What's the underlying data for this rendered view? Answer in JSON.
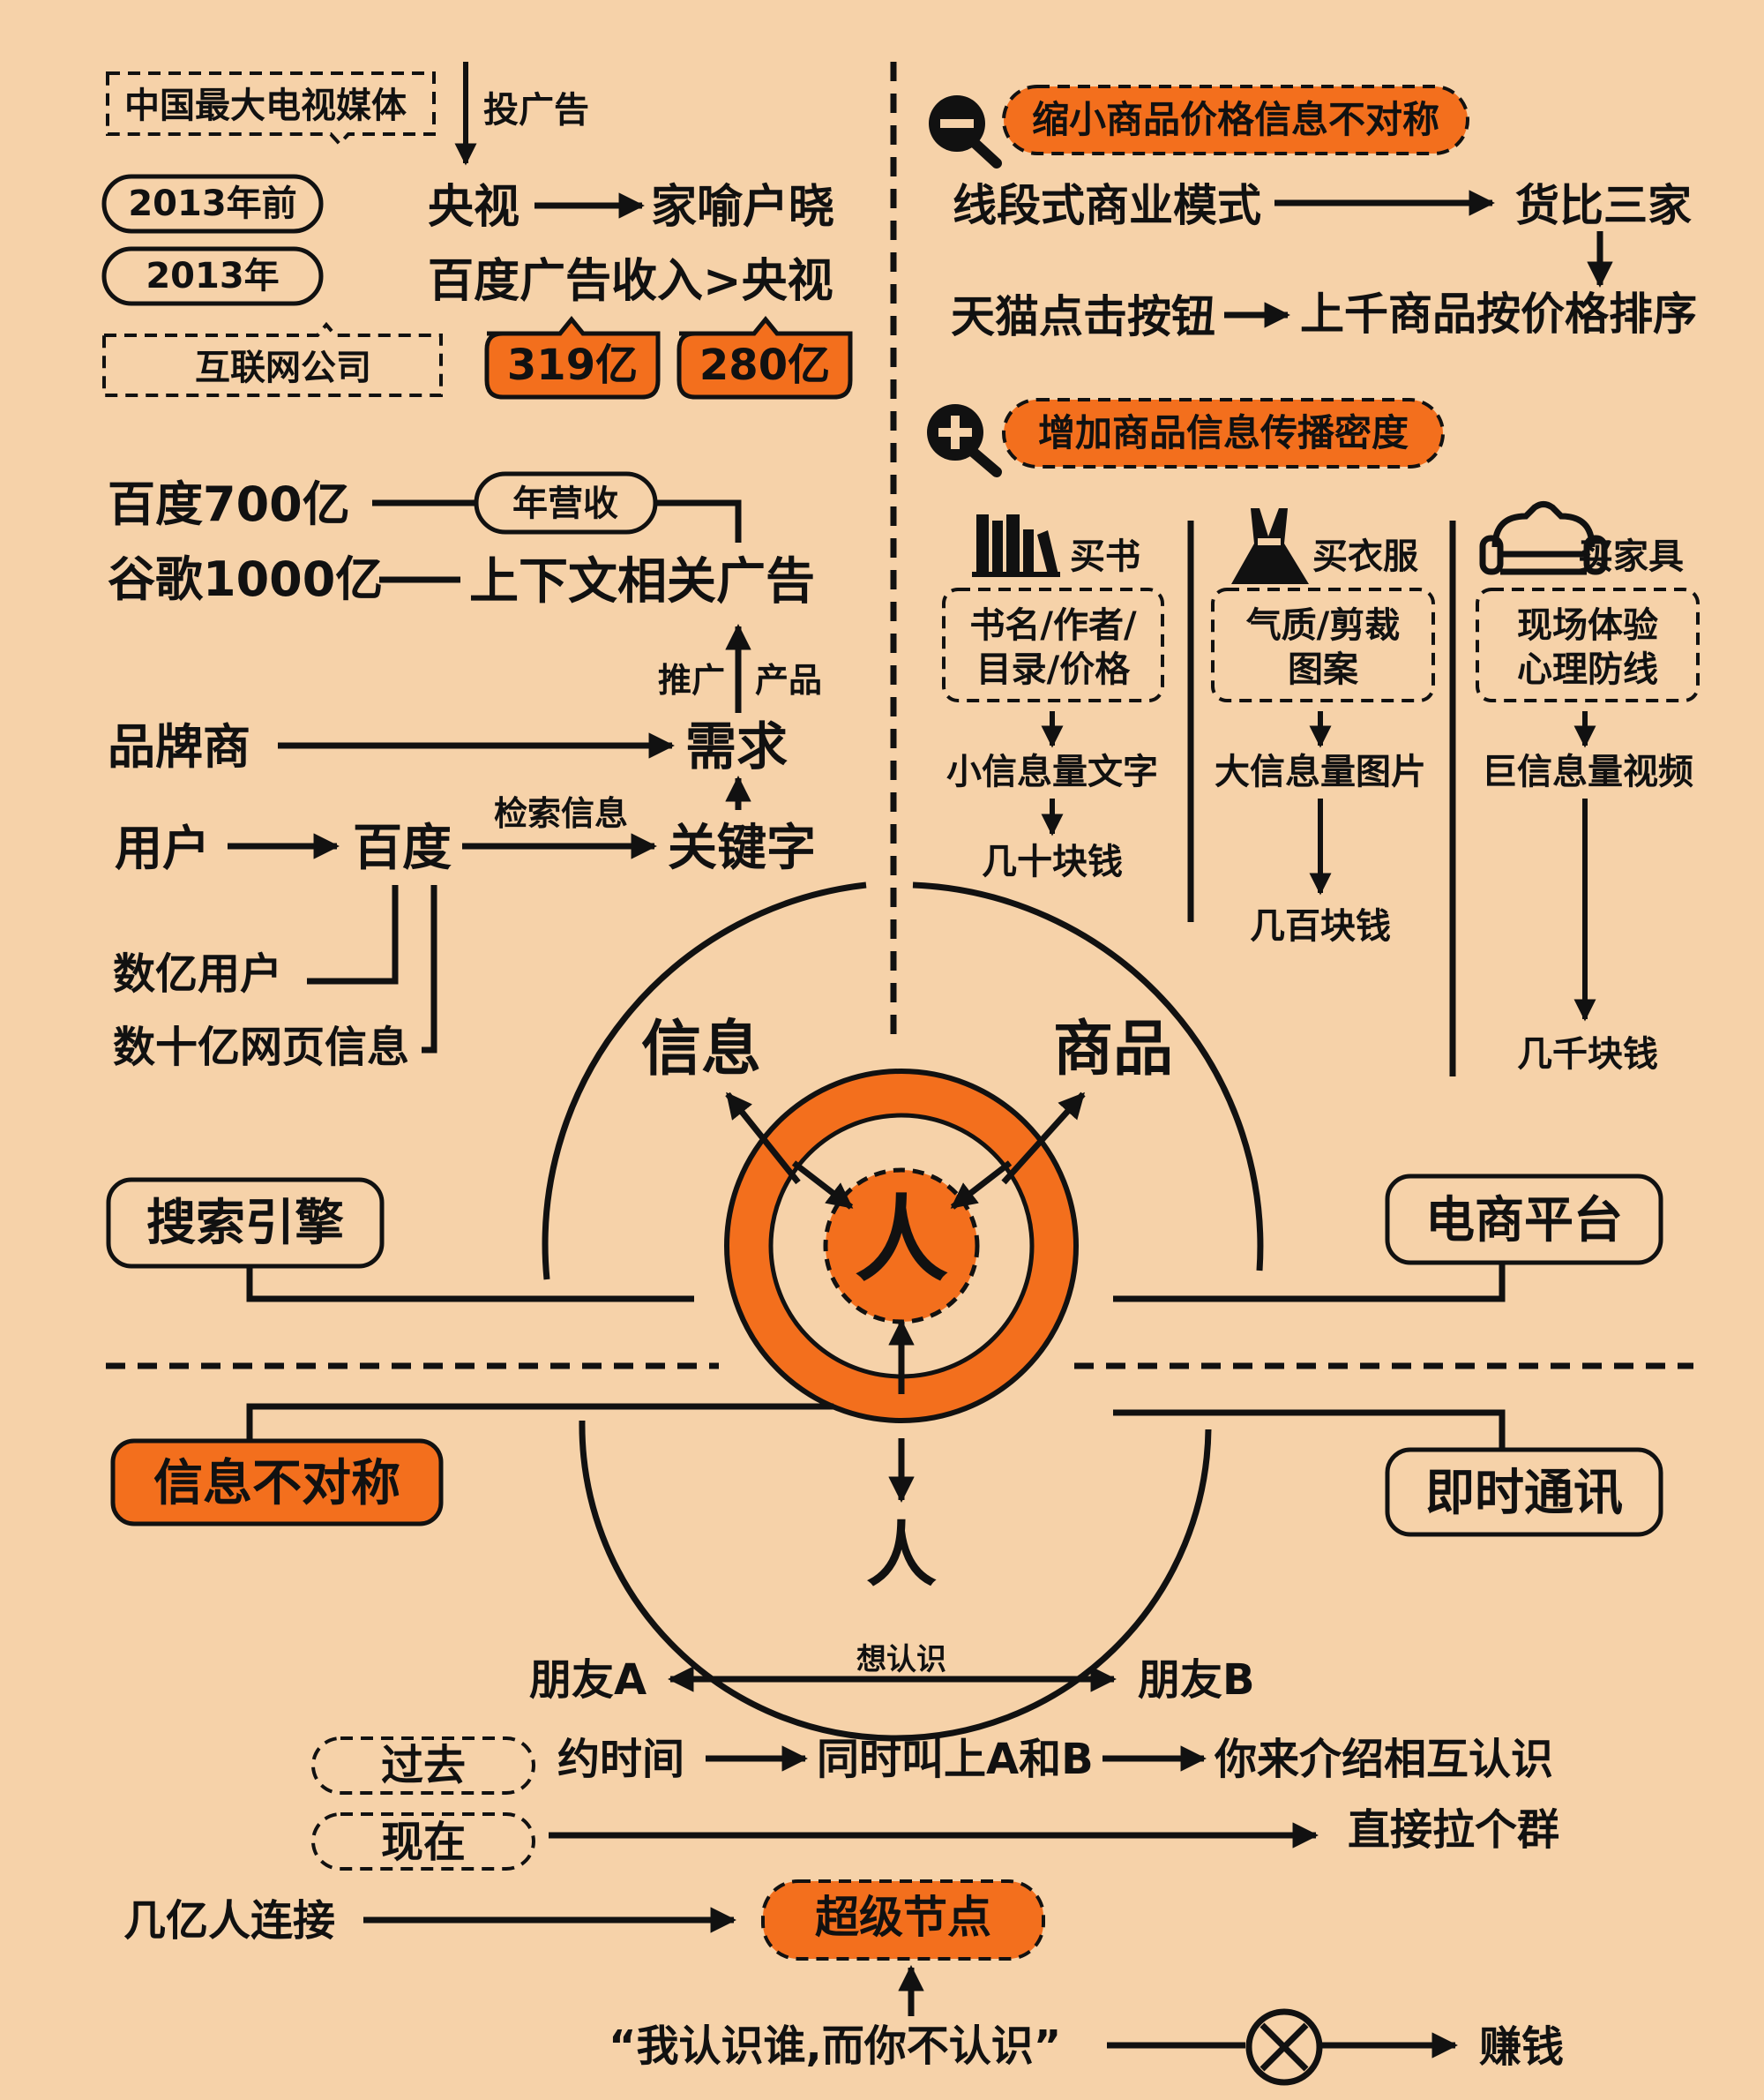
{
  "colors": {
    "background": "#f6d2a9",
    "accent": "#f36f1d",
    "ink": "#111111"
  },
  "top_left": {
    "cctv_media": "中国最大电视媒体",
    "advertise": "投广告",
    "before_2013": "2013年前",
    "in_2013": "2013年",
    "internet_company": "互联网公司",
    "cctv": "央视",
    "household": "家喻户晓",
    "baidu_vs_cctv": "百度广告收入>央视",
    "val_319": "319亿",
    "val_280": "280亿"
  },
  "revenue": {
    "baidu": "百度700亿",
    "google": "谷歌1000亿",
    "annual": "年营收",
    "contextual_ads": "上下文相关广告",
    "promote": "推广",
    "product": "产品"
  },
  "search": {
    "brand": "品牌商",
    "demand": "需求",
    "user": "用户",
    "baidu": "百度",
    "retrieve": "检索信息",
    "keyword": "关键字",
    "hundreds_users": "数亿用户",
    "billions_pages": "数十亿网页信息"
  },
  "center": {
    "info": "信息",
    "goods": "商品",
    "person": "人",
    "person_bottom": "人",
    "search_engine": "搜索引擎",
    "ecommerce": "电商平台",
    "asymmetry": "信息不对称",
    "im": "即时通讯"
  },
  "ecom": {
    "reduce": "缩小商品价格信息不对称",
    "linear_model": "线段式商业模式",
    "compare": "货比三家",
    "tmall": "天猫点击按钮",
    "sort": "上千商品按价格排序",
    "increase": "增加商品信息传播密度",
    "cols": [
      {
        "icon": "books-icon",
        "title": "买书",
        "l1": "书名/作者/",
        "l2": "目录/价格",
        "mid": "小信息量文字",
        "price": "几十块钱"
      },
      {
        "icon": "dress-icon",
        "title": "买衣服",
        "l1": "气质/剪裁",
        "l2": "图案",
        "mid": "大信息量图片",
        "price": "几百块钱"
      },
      {
        "icon": "sofa-icon",
        "title": "买家具",
        "l1": "现场体验",
        "l2": "心理防线",
        "mid": "巨信息量视频",
        "price": "几千块钱"
      }
    ]
  },
  "social": {
    "want_know": "想认识",
    "friend_a": "朋友A",
    "friend_b": "朋友B",
    "past": "过去",
    "make_time": "约时间",
    "call_both": "同时叫上A和B",
    "introduce": "你来介绍相互认识",
    "now": "现在",
    "group": "直接拉个群",
    "connect": "几亿人连接",
    "super_node": "超级节点",
    "quote": "“我认识谁,而你不认识”",
    "earn": "赚钱"
  }
}
